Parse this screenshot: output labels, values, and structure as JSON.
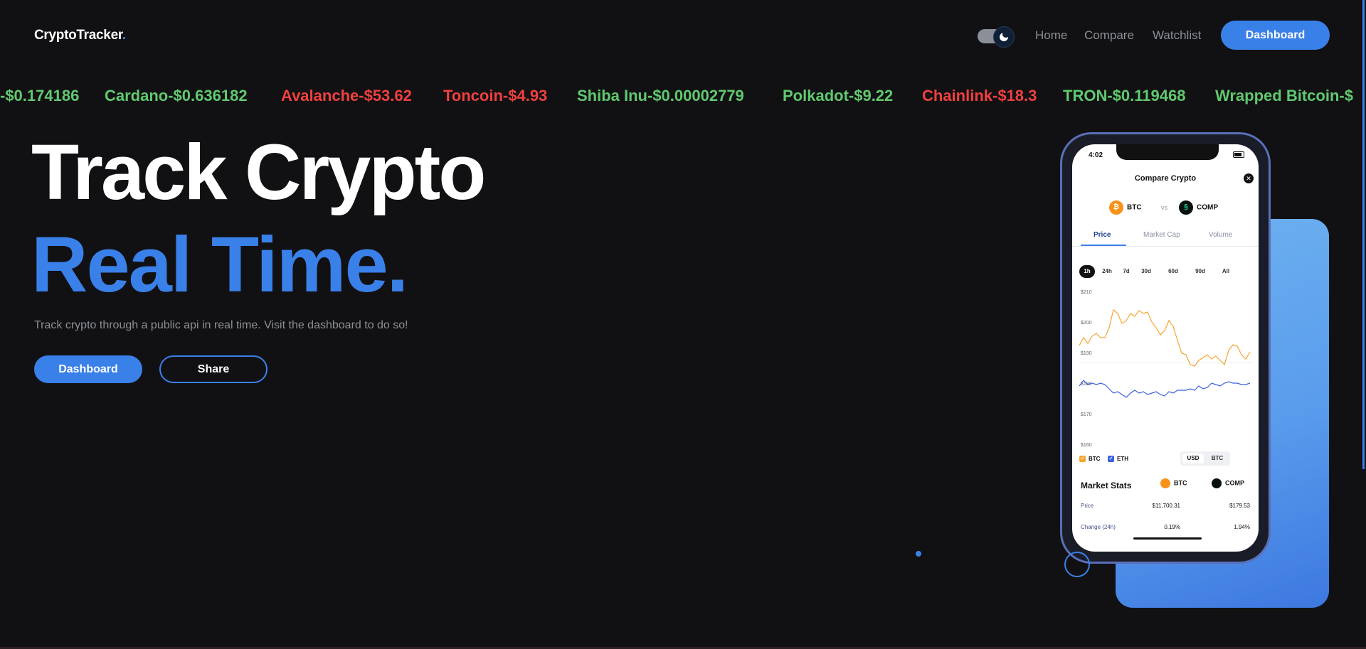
{
  "nav": {
    "logo": "CryptoTracker",
    "logo_dot": ".",
    "links": [
      "Home",
      "Compare",
      "Watchlist"
    ],
    "cta": "Dashboard"
  },
  "ticker": [
    {
      "text": "-$0.174186",
      "dir": "up"
    },
    {
      "text": "Cardano-$0.636182",
      "dir": "up"
    },
    {
      "text": "Avalanche-$53.62",
      "dir": "down"
    },
    {
      "text": "Toncoin-$4.93",
      "dir": "down"
    },
    {
      "text": "Shiba Inu-$0.00002779",
      "dir": "up"
    },
    {
      "text": "Polkadot-$9.22",
      "dir": "up"
    },
    {
      "text": "Chainlink-$18.3",
      "dir": "down"
    },
    {
      "text": "TRON-$0.119468",
      "dir": "up"
    },
    {
      "text": "Wrapped Bitcoin-$",
      "dir": "up"
    }
  ],
  "hero": {
    "line1": "Track Crypto",
    "line2": "Real Time.",
    "subtitle": "Track crypto through a public api in real time. Visit the dashboard to do so!",
    "primary_button": "Dashboard",
    "secondary_button": "Share"
  },
  "phone": {
    "time": "4:02",
    "title": "Compare Crypto",
    "coin_a": "BTC",
    "vs": "vs",
    "coin_b": "COMP",
    "tabs": [
      "Price",
      "Market Cap",
      "Volume"
    ],
    "ranges": [
      "1h",
      "24h",
      "7d",
      "30d",
      "60d",
      "90d",
      "All"
    ],
    "y_labels": [
      "$210",
      "$200",
      "$190",
      "$180",
      "$170",
      "$160"
    ],
    "legend": [
      "BTC",
      "ETH"
    ],
    "currency": [
      "USD",
      "BTC"
    ],
    "stats": {
      "title": "Market Stats",
      "col_a": "BTC",
      "col_b": "COMP",
      "rows": [
        {
          "label": "Price",
          "a": "$11,700.31",
          "b": "$179.53"
        },
        {
          "label": "Change (24h)",
          "a": "0.19%",
          "b": "1.94%"
        }
      ]
    }
  },
  "colors": {
    "accent": "#3a80e9",
    "up": "#61c96f",
    "down": "#f0403e",
    "background": "#111113",
    "btc_line": "#f7a530",
    "eth_line": "#3a5fe0"
  }
}
